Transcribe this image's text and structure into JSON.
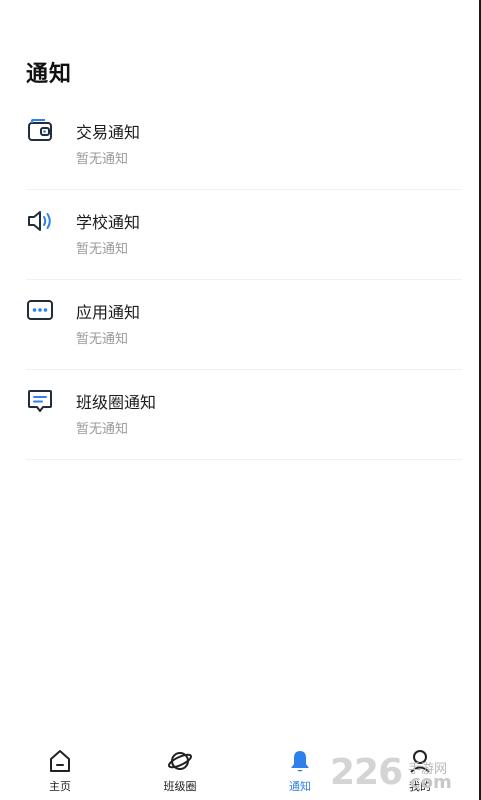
{
  "header": {
    "title": "通知"
  },
  "notices": [
    {
      "name": "交易通知",
      "status": "暂无通知",
      "icon": "wallet-icon"
    },
    {
      "name": "学校通知",
      "status": "暂无通知",
      "icon": "speaker-icon"
    },
    {
      "name": "应用通知",
      "status": "暂无通知",
      "icon": "message-dots-icon"
    },
    {
      "name": "班级圈通知",
      "status": "暂无通知",
      "icon": "chat-bubble-icon"
    }
  ],
  "tabbar": {
    "tabs": [
      {
        "label": "主页",
        "icon": "home-icon",
        "active": false
      },
      {
        "label": "班级圈",
        "icon": "planet-icon",
        "active": false
      },
      {
        "label": "通知",
        "icon": "bell-icon",
        "active": true
      },
      {
        "label": "我的",
        "icon": "person-icon",
        "active": false
      }
    ]
  },
  "watermark": {
    "number": "226",
    "site_cn": "手游网",
    "domain": "com"
  },
  "colors": {
    "accent": "#2f80ed",
    "icon_dark": "#1f2d3d",
    "sub_text": "#9a9a9a"
  }
}
